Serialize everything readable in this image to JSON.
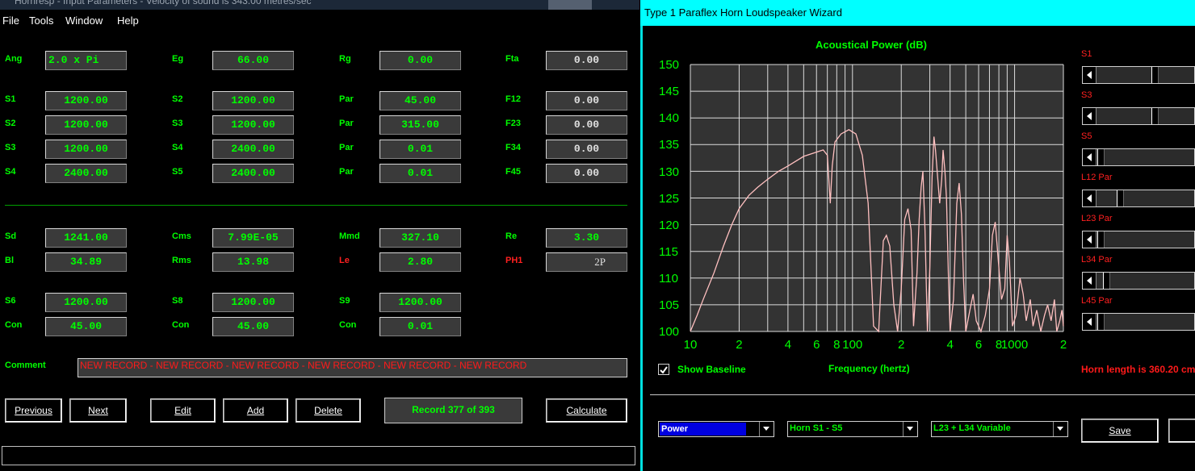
{
  "left_window": {
    "title": "Hornresp - Input Parameters - Velocity of sound is 343.00 metres/sec",
    "menu": [
      "File",
      "Tools",
      "Window",
      "Help"
    ],
    "params": {
      "ang": {
        "label": "Ang",
        "value": "2.0 x Pi"
      },
      "eg": {
        "label": "Eg",
        "value": "66.00"
      },
      "rg": {
        "label": "Rg",
        "value": "0.00"
      },
      "fta": {
        "label": "Fta",
        "value": "0.00"
      },
      "s1": {
        "label": "S1",
        "value": "1200.00"
      },
      "s2a": {
        "label": "S2",
        "value": "1200.00"
      },
      "par1": {
        "label": "Par",
        "value": "45.00"
      },
      "f12": {
        "label": "F12",
        "value": "0.00"
      },
      "s2": {
        "label": "S2",
        "value": "1200.00"
      },
      "s3a": {
        "label": "S3",
        "value": "1200.00"
      },
      "par2": {
        "label": "Par",
        "value": "315.00"
      },
      "f23": {
        "label": "F23",
        "value": "0.00"
      },
      "s3": {
        "label": "S3",
        "value": "1200.00"
      },
      "s4a": {
        "label": "S4",
        "value": "2400.00"
      },
      "par3": {
        "label": "Par",
        "value": "0.01"
      },
      "f34": {
        "label": "F34",
        "value": "0.00"
      },
      "s4": {
        "label": "S4",
        "value": "2400.00"
      },
      "s5a": {
        "label": "S5",
        "value": "2400.00"
      },
      "par4": {
        "label": "Par",
        "value": "0.01"
      },
      "f45": {
        "label": "F45",
        "value": "0.00"
      },
      "sd": {
        "label": "Sd",
        "value": "1241.00"
      },
      "cms": {
        "label": "Cms",
        "value": "7.99E-05"
      },
      "mmd": {
        "label": "Mmd",
        "value": "327.10"
      },
      "re": {
        "label": "Re",
        "value": "3.30"
      },
      "bl": {
        "label": "Bl",
        "value": "34.89"
      },
      "rms": {
        "label": "Rms",
        "value": "13.98"
      },
      "le": {
        "label": "Le",
        "value": "2.80"
      },
      "ph1": {
        "label": "PH1",
        "value": "2P"
      },
      "s6": {
        "label": "S6",
        "value": "1200.00"
      },
      "s8": {
        "label": "S8",
        "value": "1200.00"
      },
      "s9": {
        "label": "S9",
        "value": "1200.00"
      },
      "con1": {
        "label": "Con",
        "value": "45.00"
      },
      "con2": {
        "label": "Con",
        "value": "45.00"
      },
      "con3": {
        "label": "Con",
        "value": "0.01"
      }
    },
    "comment_label": "Comment",
    "comment_value": "NEW RECORD - NEW RECORD - NEW RECORD - NEW RECORD - NEW RECORD - NEW RECORD",
    "buttons": {
      "previous": "Previous",
      "next": "Next",
      "edit": "Edit",
      "add": "Add",
      "delete": "Delete",
      "calculate": "Calculate"
    },
    "record_status": "Record 377 of 393"
  },
  "right_window": {
    "title": "Type 1 Paraflex Horn Loudspeaker Wizard",
    "show_baseline": "Show Baseline",
    "show_baseline_checked": true,
    "horn_length": "Horn length is 360.20 cm",
    "sliders": [
      {
        "label": "S1",
        "position": 0.6
      },
      {
        "label": "S3",
        "position": 0.6
      },
      {
        "label": "S5",
        "position": 0.0
      },
      {
        "label": "L12 Par",
        "position": 0.22
      },
      {
        "label": "L23 Par",
        "position": 0.0
      },
      {
        "label": "L34 Par",
        "position": 0.06
      },
      {
        "label": "L45 Par",
        "position": 0.0
      }
    ],
    "combos": {
      "plot": "Power",
      "horn": "Horn S1 - S5",
      "variable": "L23 + L34 Variable"
    },
    "save_label": "Save",
    "colors": {
      "plot_bg": "#333333",
      "curve": "#ffc0c0",
      "grid": "#dcdcdc",
      "text": "#00ff00",
      "accent": "#00ffff"
    }
  },
  "chart_data": {
    "type": "line",
    "title": "Acoustical Power (dB)",
    "xlabel": "Frequency (hertz)",
    "ylabel": "",
    "x_scale": "log",
    "xlim": [
      10,
      2000
    ],
    "ylim": [
      100,
      150
    ],
    "x_tick_labels": [
      "10",
      "2",
      "4",
      "6",
      "8",
      "100",
      "2",
      "4",
      "6",
      "8",
      "1000",
      "2"
    ],
    "y_tick_labels": [
      "150",
      "145",
      "140",
      "135",
      "130",
      "125",
      "120",
      "115",
      "110",
      "105",
      "100"
    ],
    "series": [
      {
        "values": [
          [
            10,
            100
          ],
          [
            11,
            103
          ],
          [
            12,
            106
          ],
          [
            14,
            111
          ],
          [
            16,
            116
          ],
          [
            18,
            120
          ],
          [
            20,
            123
          ],
          [
            23,
            125.5
          ],
          [
            26,
            127
          ],
          [
            30,
            128.5
          ],
          [
            35,
            130
          ],
          [
            40,
            131
          ],
          [
            50,
            132.8
          ],
          [
            60,
            133.6
          ],
          [
            66,
            134
          ],
          [
            70,
            133
          ],
          [
            73,
            124
          ],
          [
            75,
            131
          ],
          [
            78,
            135.5
          ],
          [
            85,
            137
          ],
          [
            95,
            137.8
          ],
          [
            105,
            137
          ],
          [
            115,
            133
          ],
          [
            125,
            124
          ],
          [
            130,
            112
          ],
          [
            135,
            101
          ],
          [
            145,
            100
          ],
          [
            155,
            117
          ],
          [
            162,
            118
          ],
          [
            170,
            116
          ],
          [
            180,
            105
          ],
          [
            190,
            100
          ],
          [
            200,
            108
          ],
          [
            210,
            121
          ],
          [
            220,
            123
          ],
          [
            230,
            119
          ],
          [
            238,
            101
          ],
          [
            250,
            111
          ],
          [
            258,
            121
          ],
          [
            265,
            127
          ],
          [
            272,
            130
          ],
          [
            280,
            119
          ],
          [
            290,
            100
          ],
          [
            300,
            112
          ],
          [
            310,
            129
          ],
          [
            318,
            136.5
          ],
          [
            325,
            134
          ],
          [
            335,
            129
          ],
          [
            345,
            124
          ],
          [
            355,
            128.5
          ],
          [
            362,
            134
          ],
          [
            372,
            130
          ],
          [
            380,
            125
          ],
          [
            390,
            111
          ],
          [
            400,
            100
          ],
          [
            420,
            106
          ],
          [
            440,
            124
          ],
          [
            455,
            127.8
          ],
          [
            470,
            122
          ],
          [
            485,
            109
          ],
          [
            500,
            100
          ],
          [
            530,
            104
          ],
          [
            555,
            107
          ],
          [
            580,
            102
          ],
          [
            620,
            100
          ],
          [
            660,
            103
          ],
          [
            700,
            108
          ],
          [
            730,
            118
          ],
          [
            760,
            120.5
          ],
          [
            790,
            114
          ],
          [
            830,
            106
          ],
          [
            870,
            108
          ],
          [
            900,
            118
          ],
          [
            930,
            113
          ],
          [
            970,
            101
          ],
          [
            1020,
            103
          ],
          [
            1080,
            110
          ],
          [
            1130,
            107
          ],
          [
            1180,
            102
          ],
          [
            1250,
            106
          ],
          [
            1300,
            101
          ],
          [
            1370,
            104
          ],
          [
            1450,
            100
          ],
          [
            1530,
            103
          ],
          [
            1600,
            105
          ],
          [
            1680,
            102
          ],
          [
            1760,
            106
          ],
          [
            1820,
            100
          ],
          [
            1900,
            102
          ],
          [
            1960,
            104
          ],
          [
            2000,
            101
          ]
        ]
      }
    ]
  }
}
